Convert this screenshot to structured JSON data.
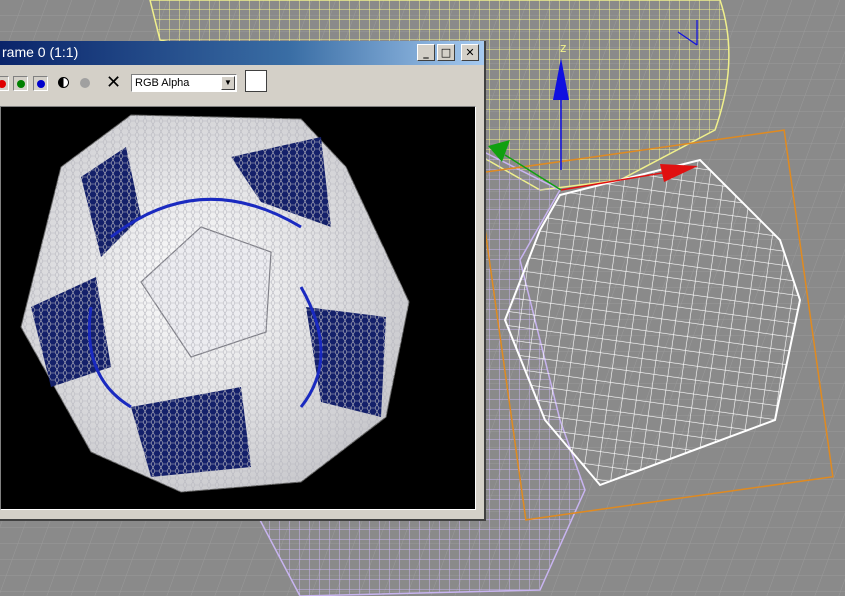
{
  "window": {
    "title": "rame 0 (1:1)",
    "minimize": "_",
    "maximize": "□",
    "close": "✕"
  },
  "toolbar": {
    "channels": [
      {
        "name": "red-channel",
        "color": "#e00000"
      },
      {
        "name": "green-channel",
        "color": "#008000"
      },
      {
        "name": "blue-channel",
        "color": "#0000cc"
      }
    ],
    "clear_symbol": "✕",
    "display_channel": "RGB Alpha",
    "swatch_color": "#ffffff"
  },
  "scene": {
    "background": "#8a8a8a",
    "axis_label": "z",
    "colors": {
      "yellow_mesh": "#f0f08c",
      "purple_mesh": "#c8b4f0",
      "white_mesh": "#ffffff",
      "selection_box": "#e08a20",
      "gizmo_z": "#1010e0",
      "gizmo_x": "#e01010",
      "gizmo_y": "#10a010"
    }
  }
}
